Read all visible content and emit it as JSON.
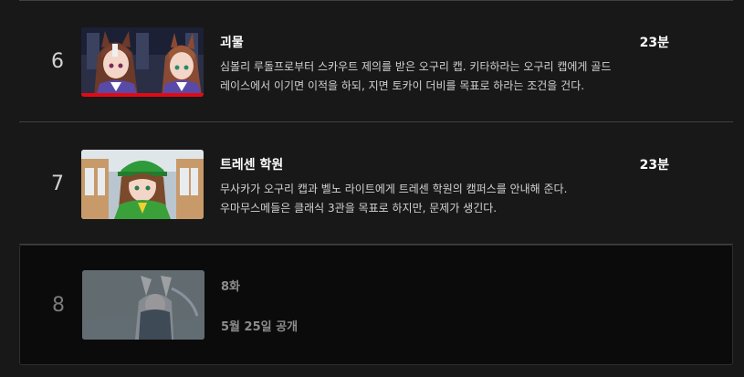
{
  "episodes": [
    {
      "number": "6",
      "title": "괴물",
      "duration": "23분",
      "description_line1": "심볼리 루돌프로부터 스카우트 제의를 받은 오구리 캡. 키타하라는 오구리 캡에게 골드",
      "description_line2": "레이스에서 이기면 이적을 하되, 지면 토카이 더비를 목표로 하라는 조건을 건다.",
      "watch_progress": 1.0,
      "thumbnail_icon": "two-horse-girls-thumbnail"
    },
    {
      "number": "7",
      "title": "트레센 학원",
      "duration": "23분",
      "description_line1": "무사카가 오구리 캡과 벨노 라이트에게 트레센 학원의 캠퍼스를 안내해 준다.",
      "description_line2": "우마무스메들은 클래식 3관을 목표로 하지만, 문제가 생긴다.",
      "thumbnail_icon": "green-cap-girl-thumbnail"
    },
    {
      "number": "8",
      "title": "8화",
      "release": "5월 25일 공개",
      "thumbnail_icon": "faded-locked-thumbnail"
    }
  ],
  "colors": {
    "background": "#181818",
    "upcoming_background": "#0b0b0b",
    "progress": "#e50914",
    "divider": "#404040"
  }
}
